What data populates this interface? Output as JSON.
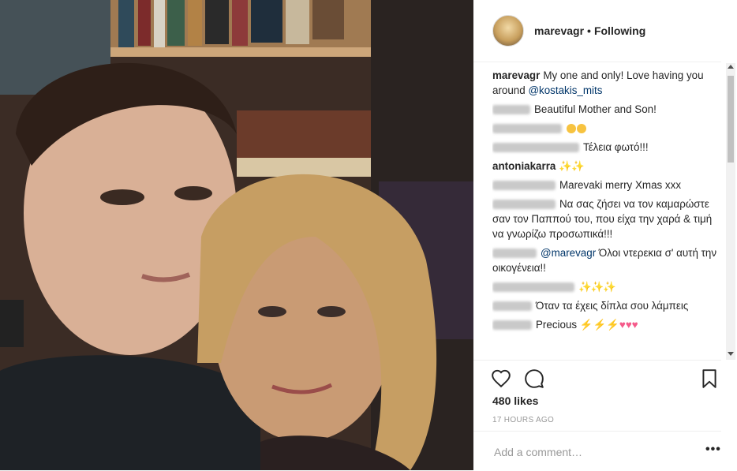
{
  "post": {
    "username": "marevagr",
    "follow_status": "Following",
    "likes": "480 likes",
    "time": "17 HOURS AGO",
    "add_comment_placeholder": "Add a comment…",
    "more_label": "•••"
  },
  "caption": {
    "username": "marevagr",
    "text": "My one and only! Love having you around",
    "mention": "@kostakis_mits"
  },
  "comments": [
    {
      "text": "Beautiful Mother and Son!"
    },
    {
      "text": ""
    },
    {
      "text": "Τέλεια φωτό!!!"
    },
    {
      "username": "antoniakarra",
      "text": "✨✨"
    },
    {
      "text": "Marevaki merry Xmas xxx"
    },
    {
      "text": "Να σας ζήσει να τον καμαρώστε σαν τον Παππού του, που είχα την χαρά & τιμή να γνωρίζω προσωπικά!!!"
    },
    {
      "mention": "@marevagr",
      "text": "Όλοι ντερεκια σ' αυτή την οικογένεια!!"
    },
    {
      "text": "✨✨✨"
    },
    {
      "text": "Όταν τα έχεις δίπλα σου λάμπεις"
    },
    {
      "text": "Precious"
    }
  ],
  "icons": {
    "like": "heart-outline-icon",
    "comment": "comment-bubble-icon",
    "save": "bookmark-icon"
  }
}
